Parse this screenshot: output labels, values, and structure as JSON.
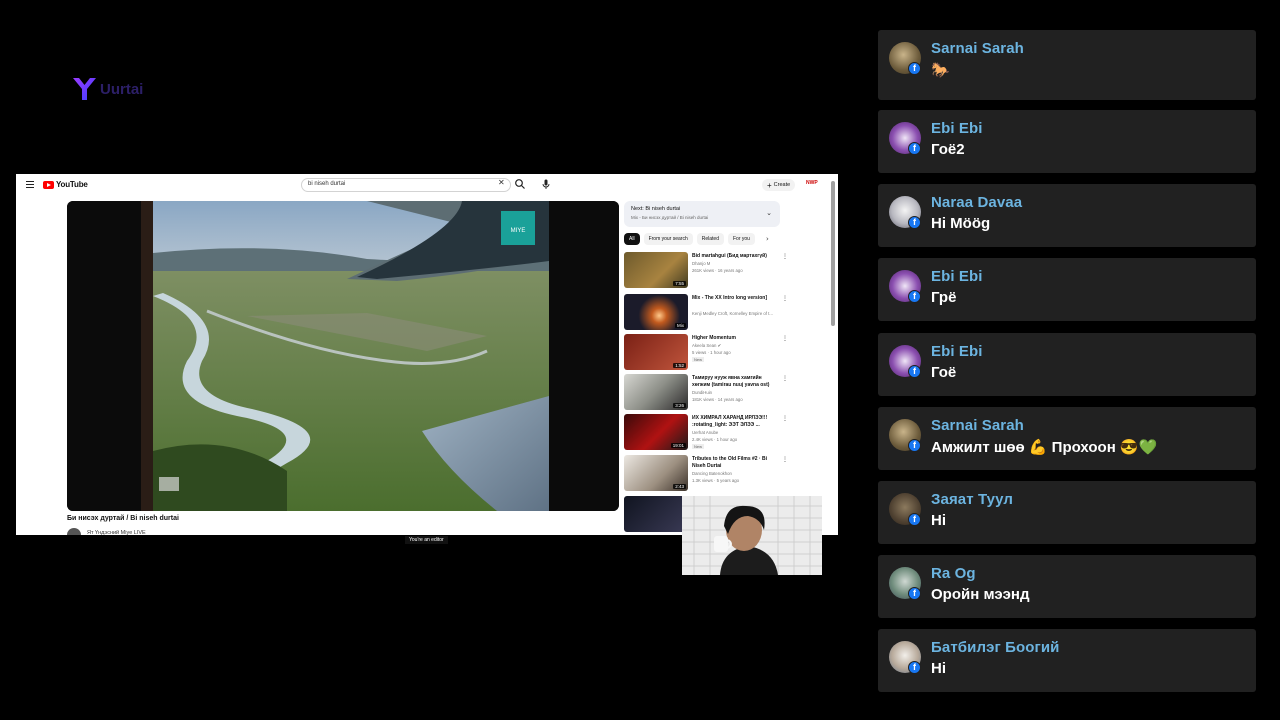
{
  "brand": {
    "logo_text": "Uurtai"
  },
  "youtube": {
    "logo_label": "YouTube",
    "search_value": "bi niseh durtai",
    "create_label": "Create",
    "account_badge": "NWP",
    "video": {
      "title": "Би нисэх дуртай / Bi niseh durtai",
      "channel": "Ят Үндэсний Miye LIVE",
      "watermark": "MIYE"
    },
    "editor_note": "You're an editor",
    "next": {
      "heading": "Next: Bi niseh durtai",
      "sub": "Mix - Би нисэх дуртай / Bi niseh durtai"
    },
    "chips": [
      "All",
      "From your search",
      "Related",
      "For you"
    ],
    "recommendations": [
      {
        "title": "Bid martahgui (Бид мартахгүй)",
        "meta1": "Dhanjo M",
        "meta2": "261K views · 16 years ago",
        "duration": "7:55",
        "badge": ""
      },
      {
        "title": "Mix - The XX  Intro long version]",
        "meta1": "Kenji Medley Croft, Kornelley Empire of t...",
        "meta2": "",
        "duration": "Mix",
        "badge": ""
      },
      {
        "title": "Higher Momentum",
        "meta1": "Akeela Sean ✔",
        "meta2": "5 views · 1 hour ago",
        "duration": "1:52",
        "badge": "New"
      },
      {
        "title": "Тамируу нууж явна хамгийн хөгжим (tamirau nuuj yavna ost)",
        "meta1": "DundiHuin",
        "meta2": "181K views · 14 years ago",
        "duration": "3:26",
        "badge": ""
      },
      {
        "title": "ИХ ХИМРАЛ ХАРАНД ИРЛЭЭ!!! :rotating_light: ЭЭТ ЭЛЭЭ ...",
        "meta1": "Uerhat Anube",
        "meta2": "2.4K views · 1 hour ago",
        "duration": "19:01",
        "badge": "New"
      },
      {
        "title": "Tributes to the Old Films #2 · Bi Niseh Durtai",
        "meta1": "Dancing Batenokhon",
        "meta2": "1.3K views · 5 years ago",
        "duration": "2:43",
        "badge": ""
      }
    ]
  },
  "chat": [
    {
      "name": "Sarnai Sarah",
      "message": "🐎"
    },
    {
      "name": "Ebi Ebi",
      "message": "Гоё2"
    },
    {
      "name": "Naraa Davaa",
      "message": "Hi Möög"
    },
    {
      "name": "Ebi Ebi",
      "message": "Грё"
    },
    {
      "name": "Ebi Ebi",
      "message": "Гоё"
    },
    {
      "name": "Sarnai Sarah",
      "message": "Амжилт шөө 💪 Прохоон 😎💚"
    },
    {
      "name": "Заяат Туул",
      "message": "Hi"
    },
    {
      "name": "Ra Og",
      "message": "Оройн мээнд"
    },
    {
      "name": "Батбилэг Боогий",
      "message": "Hi"
    }
  ]
}
